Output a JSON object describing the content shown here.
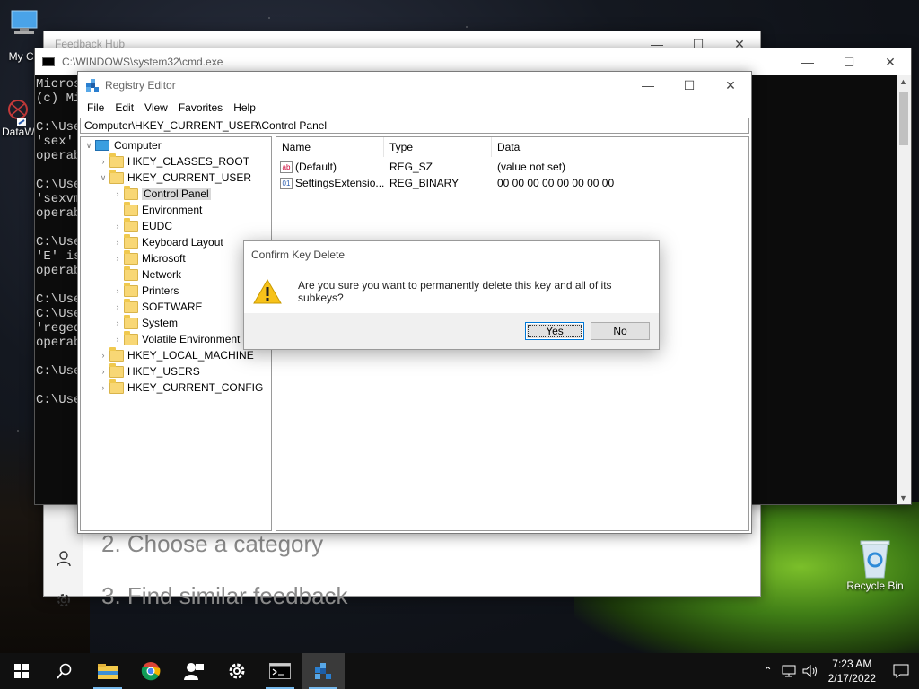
{
  "desktop": {
    "icons": [
      {
        "label": "My Co"
      },
      {
        "label": "DataW"
      },
      {
        "label": "Recycle Bin"
      }
    ]
  },
  "feedback_hub": {
    "title": "Feedback Hub",
    "steps": [
      "2. Choose a category",
      "3. Find similar feedback"
    ]
  },
  "cmd": {
    "title": "C:\\WINDOWS\\system32\\cmd.exe",
    "lines": [
      "Micros",
      "(c) Mi",
      "",
      "C:\\Use",
      "'sex' ",
      "operab",
      "",
      "C:\\Use",
      "'sexvm",
      "operab",
      "",
      "C:\\Use",
      "'E' is",
      "operab",
      "",
      "C:\\Use",
      "C:\\Use",
      "'reged",
      "operab",
      "",
      "C:\\Use",
      "",
      "C:\\Use"
    ]
  },
  "regedit": {
    "title": "Registry Editor",
    "menu": [
      "File",
      "Edit",
      "View",
      "Favorites",
      "Help"
    ],
    "address": "Computer\\HKEY_CURRENT_USER\\Control Panel",
    "tree": {
      "root": "Computer",
      "hives": [
        "HKEY_CLASSES_ROOT",
        "HKEY_CURRENT_USER",
        "HKEY_LOCAL_MACHINE",
        "HKEY_USERS",
        "HKEY_CURRENT_CONFIG"
      ],
      "current_user_children": [
        "Control Panel",
        "Environment",
        "EUDC",
        "Keyboard Layout",
        "Microsoft",
        "Network",
        "Printers",
        "SOFTWARE",
        "System",
        "Volatile Environment"
      ],
      "selected": "Control Panel"
    },
    "columns": [
      "Name",
      "Type",
      "Data"
    ],
    "values": [
      {
        "name": "(Default)",
        "type": "REG_SZ",
        "data": "(value not set)",
        "icon": "string-value-icon"
      },
      {
        "name": "SettingsExtensio...",
        "type": "REG_BINARY",
        "data": "00 00 00 00 00 00 00 00",
        "icon": "binary-value-icon"
      }
    ]
  },
  "dialog": {
    "title": "Confirm Key Delete",
    "message": "Are you sure you want to permanently delete this key and all of its subkeys?",
    "yes_label": "Yes",
    "no_label": "No"
  },
  "taskbar": {
    "time": "7:23 AM",
    "date": "2/17/2022",
    "apps": [
      "start-icon",
      "search-icon",
      "file-explorer-icon",
      "chrome-icon",
      "people-icon",
      "settings-icon",
      "cmd-icon",
      "regedit-icon"
    ]
  },
  "colors": {
    "accent": "#0078d7",
    "taskbar": "#101010",
    "cmd_bg": "#0c0c0c",
    "folder": "#f8d775"
  }
}
